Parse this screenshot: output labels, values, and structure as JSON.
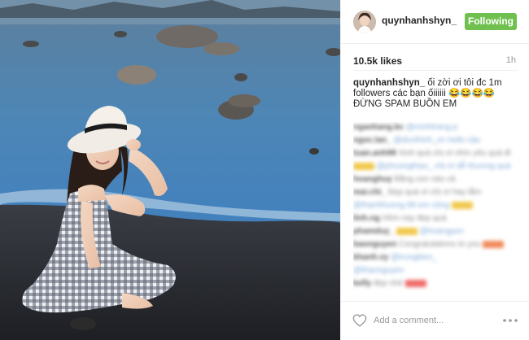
{
  "header": {
    "username": "quynhanhshyn_",
    "follow_label": "Following"
  },
  "post": {
    "likes": "10.5k likes",
    "time": "1h",
    "caption_user": "quynhanhshyn_",
    "caption_text": " ối zời ơi tôi đc 1m followers các bạn ốiiiiii 😂😂😂😂 ĐỪNG SPAM BUỒN EM"
  },
  "comments": [
    {
      "user": "nganhang.bc",
      "text": "@minhtrang.p"
    },
    {
      "user": "ngoc.lan_",
      "text": "@ducthinh_vn hello cậu"
    },
    {
      "user": "tuan.anh98",
      "text": "Xinh quá chị ơi nhìn yêu quá đi"
    },
    {
      "user": "",
      "text": "@phuongthao_ chị ơi dễ thương quá"
    },
    {
      "user": "hoanghuy",
      "text": "Bằng con nào cả"
    },
    {
      "user": "mai.chi_",
      "text": "Đẹp quá ơi chị ơi hay lắm"
    },
    {
      "user": "",
      "text": "@thanhhuong.99 em cũng"
    },
    {
      "user": "linh.ng",
      "text": "Hôm nay đẹp quá"
    },
    {
      "user": "phamduy_",
      "text": "@hoangyen"
    },
    {
      "user": "baonguyen",
      "text": "Congratulations to you"
    },
    {
      "user": "khanh.vy",
      "text": "@trungkien_"
    },
    {
      "user": "",
      "text": "@thaonguyen"
    },
    {
      "user": "kelly",
      "text": "đẹp nhé"
    }
  ],
  "footer": {
    "comment_placeholder": "Add a comment..."
  },
  "colors": {
    "follow_button": "#70c050",
    "text": "#262626",
    "muted": "#999999"
  },
  "icons": {
    "heart": "heart-icon",
    "more": "more-options-icon"
  }
}
